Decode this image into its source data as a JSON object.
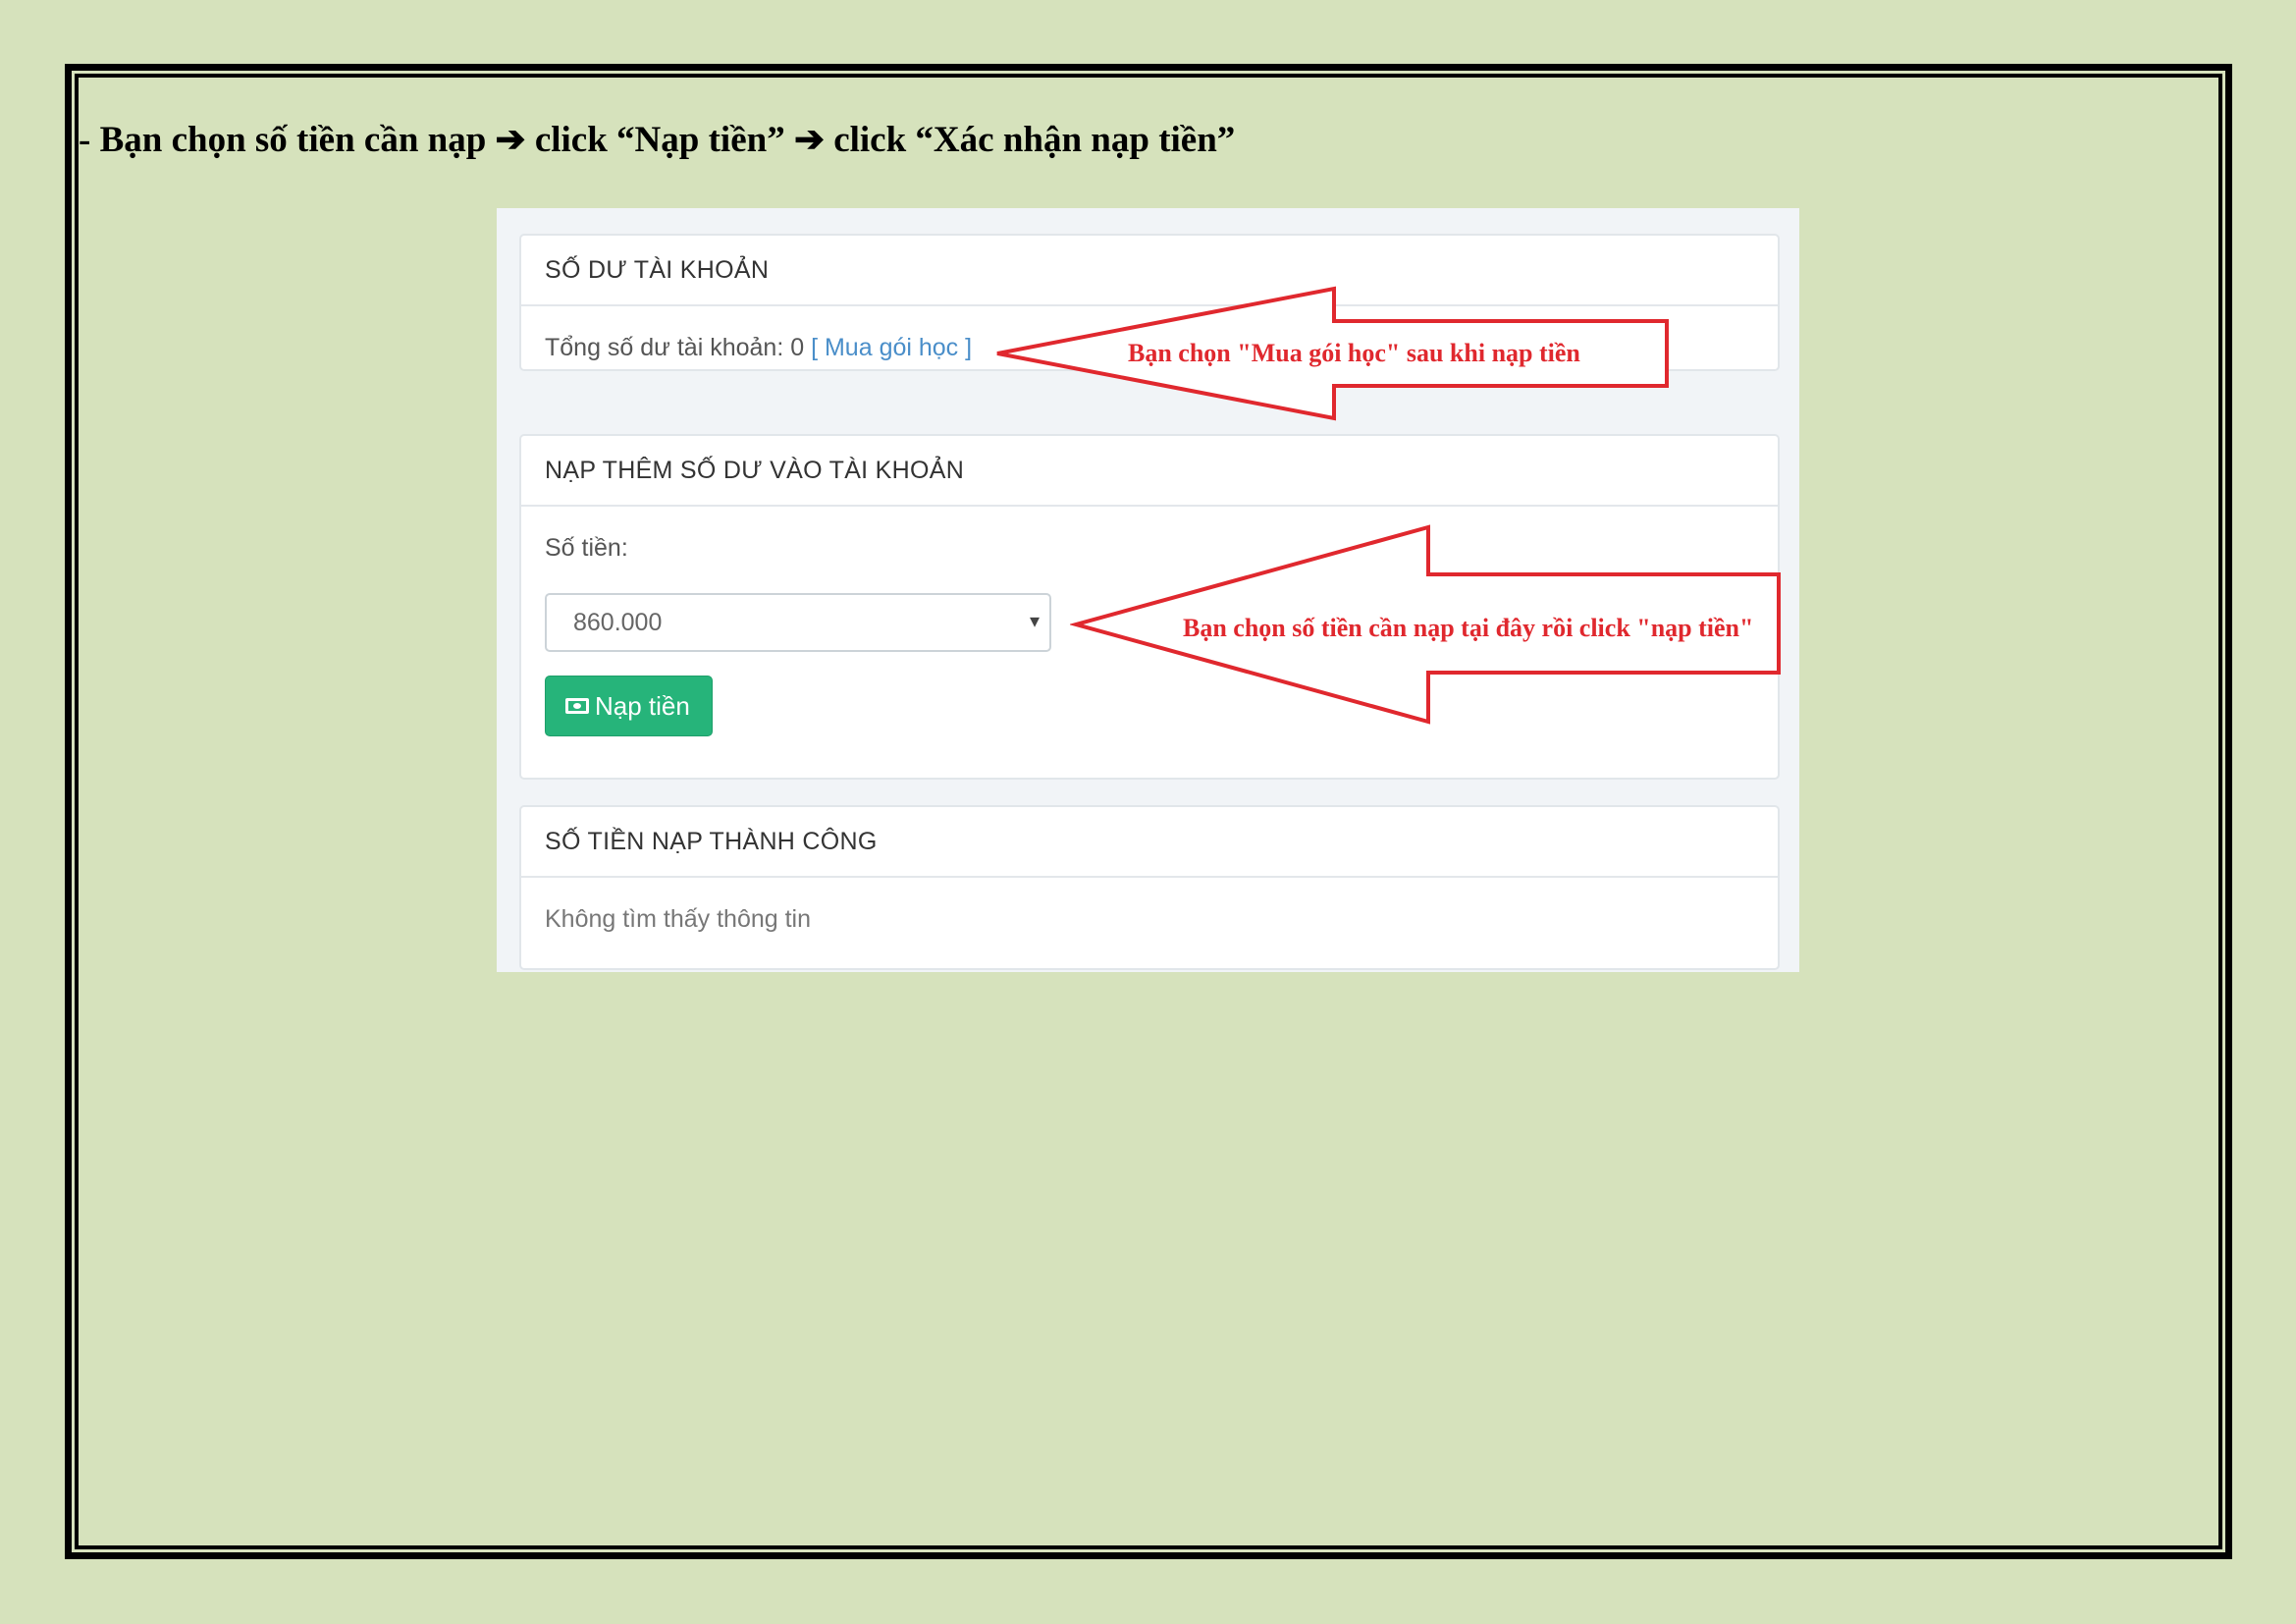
{
  "instruction": "- Bạn chọn số tiền cần nạp ➔ click “Nạp tiền” ➔ click “Xác nhận nạp tiền”",
  "balance_panel": {
    "title": "SỐ DƯ TÀI KHOẢN",
    "balance_label": "Tổng số dư tài khoản: ",
    "balance_value": "0",
    "buy_link": "[ Mua gói học ]"
  },
  "topup_panel": {
    "title": "NẠP THÊM SỐ DƯ VÀO TÀI KHOẢN",
    "amount_label": "Số tiền:",
    "amount_selected": "860.000",
    "submit_label": "Nạp tiền"
  },
  "history_panel": {
    "title": "SỐ TIỀN NẠP THÀNH CÔNG",
    "empty_message": "Không tìm thấy thông tin"
  },
  "callouts": {
    "buy_hint": "Bạn chọn \"Mua gói học\" sau khi nạp tiền",
    "amount_hint": "Bạn chọn số tiền cần nạp tại đây rồi click \"nạp tiền\""
  },
  "icons": {
    "submit": "money-icon",
    "select": "caret-down-icon"
  },
  "colors": {
    "page_bg": "#d6e2bc",
    "button": "#26b47a",
    "link": "#4a8ec9",
    "callout": "#e0282e"
  }
}
